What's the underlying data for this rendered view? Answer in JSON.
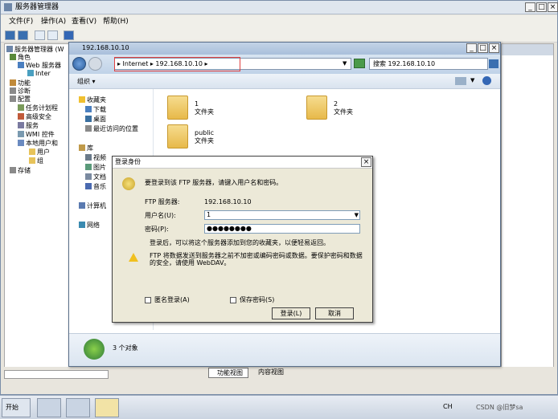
{
  "outer_window": {
    "title": "服务器管理器",
    "menu": [
      "文件(F)",
      "操作(A)",
      "查看(V)",
      "帮助(H)"
    ],
    "tree": [
      "服务器管理器 (W",
      "角色",
      "Web 服务器",
      "Inter",
      "功能",
      "诊断",
      "配置",
      "任务计划程",
      "高级安全",
      "服务",
      "WMI 控件",
      "本地用户和",
      "用户",
      "组",
      "存储"
    ],
    "bottom_tabs": [
      "功能视图",
      "内容视图"
    ]
  },
  "explorer": {
    "title": "192.168.10.10",
    "address": "▸ Internet ▸ 192.168.10.10 ▸",
    "search_placeholder": "搜索 192.168.10.10",
    "organize_label": "组织 ▾",
    "nav": {
      "favorites": "收藏夹",
      "downloads": "下载",
      "desktop": "桌面",
      "recent": "最近访问的位置",
      "library": "库",
      "videos": "视频",
      "pictures": "图片",
      "documents": "文档",
      "music": "音乐",
      "computer": "计算机",
      "network": "网络"
    },
    "items": [
      {
        "name": "1",
        "type": "文件夹"
      },
      {
        "name": "2",
        "type": "文件夹"
      },
      {
        "name": "public",
        "type": "文件夹"
      }
    ],
    "status": "3 个对象"
  },
  "login_dialog": {
    "title": "登录身份",
    "prompt": "要登录到该 FTP 服务器，请键入用户名和密码。",
    "ftp_server_label": "FTP 服务器:",
    "ftp_server_value": "192.168.10.10",
    "username_label": "用户名(U):",
    "username_value": "1",
    "password_label": "密码(P):",
    "password_value": "●●●●●●●●",
    "info_text": "登录后，可以将这个服务器添加到您的收藏夹，以便轻易返回。",
    "warning_line1": "FTP 将数据发送到服务器之前不加密或编码密码或数据。要保护密码和数据",
    "warning_line2": "的安全，请使用 WebDAV。",
    "anonymous_label": "匿名登录(A)",
    "save_password_label": "保存密码(S)",
    "login_button": "登录(L)",
    "cancel_button": "取消"
  },
  "taskbar": {
    "start_label": "开始",
    "lang": "CH",
    "watermark": "CSDN @旧梦sa"
  },
  "colors": {
    "highlight_box": "#e04040",
    "title_gradient": "#a9bfdb"
  }
}
